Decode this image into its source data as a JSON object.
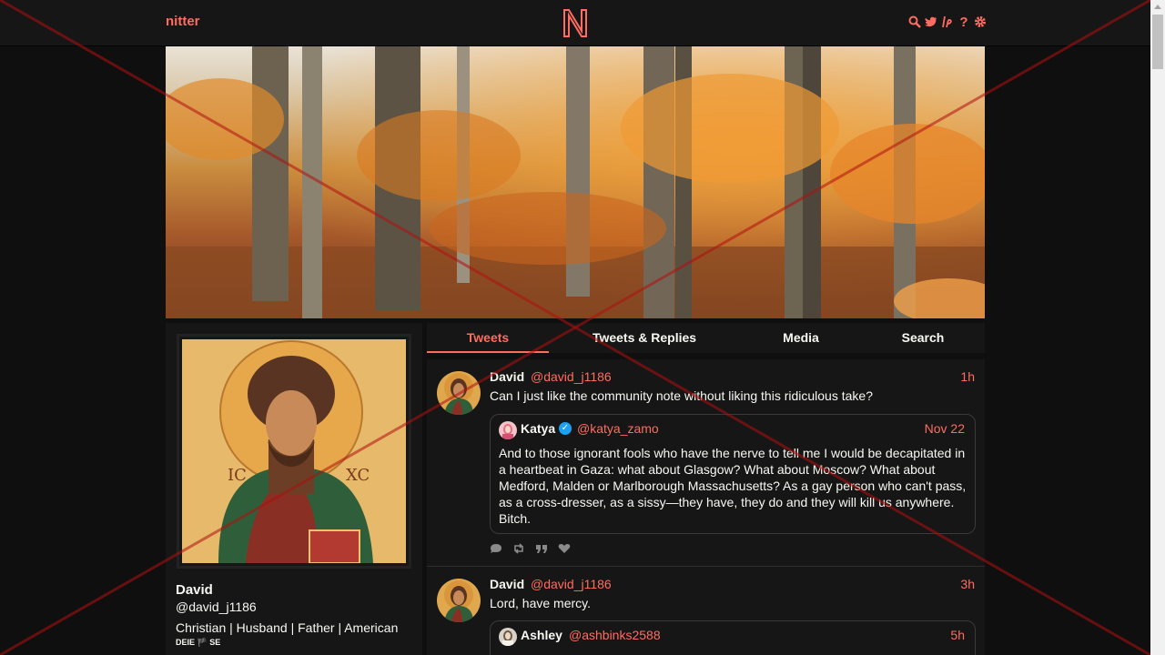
{
  "navbar": {
    "brand": "nitter",
    "icons": [
      "search-icon",
      "twitter-bird-icon",
      "lp-icon",
      "help-icon",
      "gear-icon"
    ],
    "help_label": "?"
  },
  "colors": {
    "accent": "#ff6c60",
    "background": "#0f0f0f",
    "panel": "#161616",
    "text": "#f8f8f2",
    "verified": "#1da1f2"
  },
  "profile": {
    "name": "David",
    "handle": "@david_j1186",
    "bio": "Christian | Husband | Father | American",
    "bio_line2": "DEIE 🏴 SE"
  },
  "tabs": [
    {
      "label": "Tweets",
      "active": true
    },
    {
      "label": "Tweets & Replies",
      "active": false
    },
    {
      "label": "Media",
      "active": false
    },
    {
      "label": "Search",
      "active": false
    }
  ],
  "tweets": [
    {
      "name": "David",
      "handle": "@david_j1186",
      "date": "1h",
      "text": "Can I just like the community note without liking this ridiculous take?",
      "quote": {
        "name": "Katya",
        "verified": true,
        "handle": "@katya_zamo",
        "date": "Nov 22",
        "text": "And to those ignorant fools who have the nerve to tell me I would be decapitated in a heartbeat in Gaza: what about Glasgow? What about Moscow? What about Medford, Malden or Marlborough Massachusetts? As a gay person who can't pass, as a cross-dresser, as a sissy—they have, they do and they will kill us anywhere. Bitch."
      },
      "stat_icons": [
        "comment-icon",
        "retweet-icon",
        "quote-icon",
        "heart-icon"
      ]
    },
    {
      "name": "David",
      "handle": "@david_j1186",
      "date": "3h",
      "text": "Lord, have mercy.",
      "quote": {
        "name": "Ashley",
        "verified": false,
        "handle": "@ashbinks2588",
        "date": "5h",
        "text": ""
      }
    }
  ]
}
